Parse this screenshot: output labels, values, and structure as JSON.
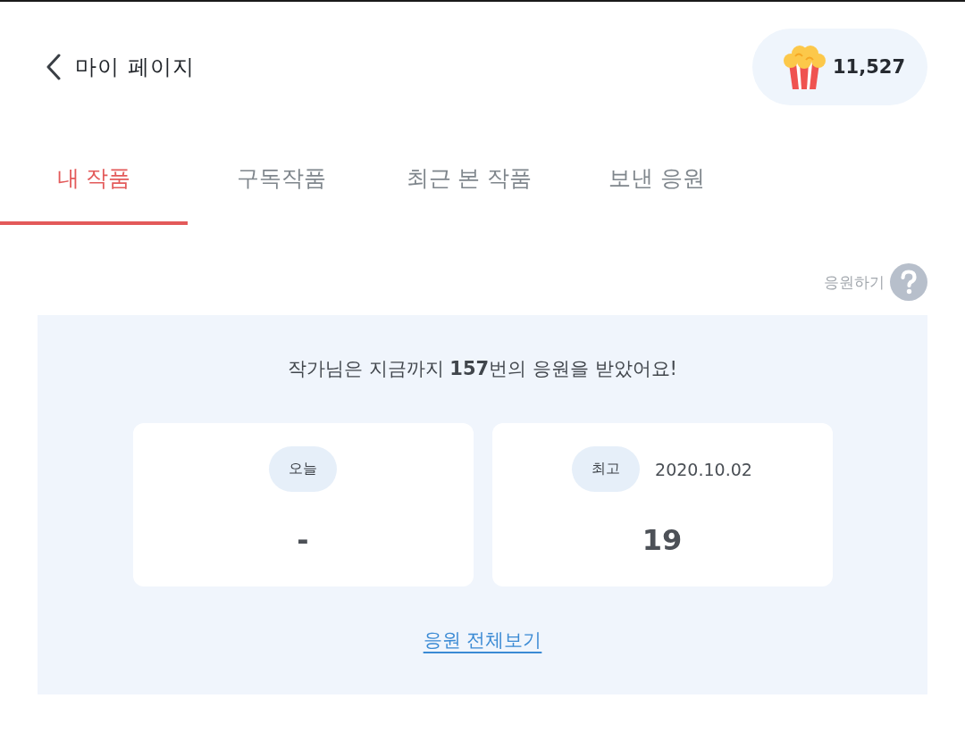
{
  "header": {
    "title": "마이 페이지",
    "points": "11,527"
  },
  "tabs": [
    {
      "label": "내 작품",
      "selected": true
    },
    {
      "label": "구독작품",
      "selected": false
    },
    {
      "label": "최근 본 작품",
      "selected": false
    },
    {
      "label": "보낸 응원",
      "selected": false
    }
  ],
  "help": {
    "label": "응원하기"
  },
  "cheer_panel": {
    "headline": "작가님은 지금까지 **157**번의 응원을 받았어요!",
    "stats": [
      {
        "badge": "오늘",
        "value": "-"
      },
      {
        "badge": "최고",
        "date": "2020.10.02",
        "value": "19"
      }
    ],
    "link": "응원 전체보기"
  }
}
